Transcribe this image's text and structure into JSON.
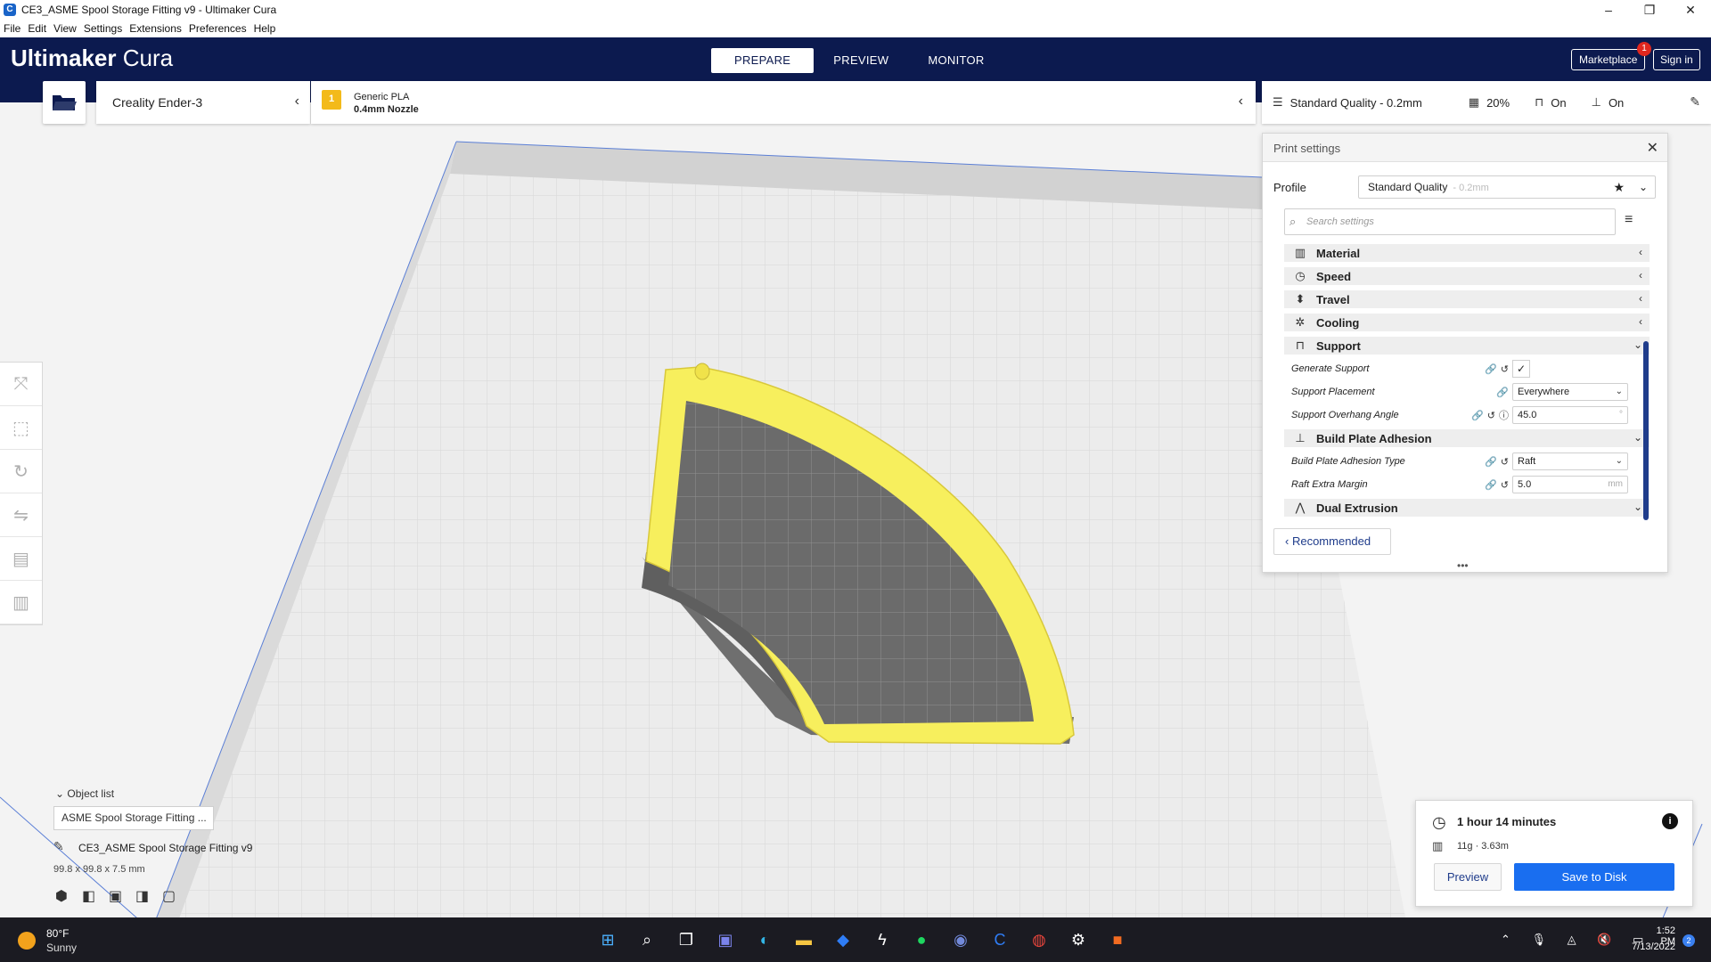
{
  "window": {
    "title": "CE3_ASME Spool Storage Fitting v9 - Ultimaker Cura",
    "app_icon": "C",
    "controls": [
      "–",
      "❐",
      "✕"
    ]
  },
  "menu": [
    "File",
    "Edit",
    "View",
    "Settings",
    "Extensions",
    "Preferences",
    "Help"
  ],
  "header": {
    "brand_bold": "Ultimaker",
    "brand_light": " Cura",
    "stages": [
      "PREPARE",
      "PREVIEW",
      "MONITOR"
    ],
    "active_stage": "PREPARE",
    "marketplace_label": "Marketplace",
    "marketplace_badge": "1",
    "signin_label": "Sign in",
    "colors": {
      "bg": "#0c1a4f",
      "accent": "#196ef0"
    }
  },
  "printer": {
    "name": "Creality Ender-3"
  },
  "extruder": {
    "badge": "1",
    "material": "Generic PLA",
    "nozzle": "0.4mm Nozzle",
    "material_color": "#f3ba1a"
  },
  "quality": {
    "profile": "Standard Quality - 0.2mm",
    "infill": "20%",
    "support": "On",
    "adhesion": "On"
  },
  "panel": {
    "title": "Print settings",
    "profile_label": "Profile",
    "profile_value": "Standard Quality",
    "profile_sub": "- 0.2mm",
    "search_placeholder": "Search settings",
    "categories_top": [
      {
        "icon": "material-icon",
        "glyph": "▥",
        "label": "Material",
        "arrow": "‹"
      },
      {
        "icon": "speed-icon",
        "glyph": "◷",
        "label": "Speed",
        "arrow": "‹"
      },
      {
        "icon": "travel-icon",
        "glyph": "⬍",
        "label": "Travel",
        "arrow": "‹"
      },
      {
        "icon": "cooling-icon",
        "glyph": "✲",
        "label": "Cooling",
        "arrow": "‹"
      }
    ],
    "support": {
      "label": "Support",
      "arrow": "⌄"
    },
    "support_settings": {
      "generate_support": {
        "label": "Generate Support",
        "checked": "✓"
      },
      "placement": {
        "label": "Support Placement",
        "value": "Everywhere"
      },
      "overhang": {
        "label": "Support Overhang Angle",
        "value": "45.0",
        "unit": "°"
      }
    },
    "adhesion": {
      "label": "Build Plate Adhesion",
      "arrow": "⌄"
    },
    "adhesion_settings": {
      "type": {
        "label": "Build Plate Adhesion Type",
        "value": "Raft"
      },
      "margin": {
        "label": "Raft Extra Margin",
        "value": "5.0",
        "unit": "mm"
      }
    },
    "dual": {
      "label": "Dual Extrusion",
      "arrow": "⌄"
    },
    "recommended_label": "Recommended"
  },
  "objects": {
    "header": "Object list",
    "item": "ASME Spool Storage Fitting ...",
    "name": "CE3_ASME Spool Storage Fitting v9",
    "dims": "99.8 x 99.8 x 7.5 mm"
  },
  "estimate": {
    "time": "1 hour 14 minutes",
    "material": "11g · 3.63m",
    "preview_label": "Preview",
    "save_label": "Save to Disk"
  },
  "taskbar": {
    "temp": "80°F",
    "condition": "Sunny",
    "time": "1:52 PM",
    "date": "7/13/2022",
    "notifications": "2"
  }
}
